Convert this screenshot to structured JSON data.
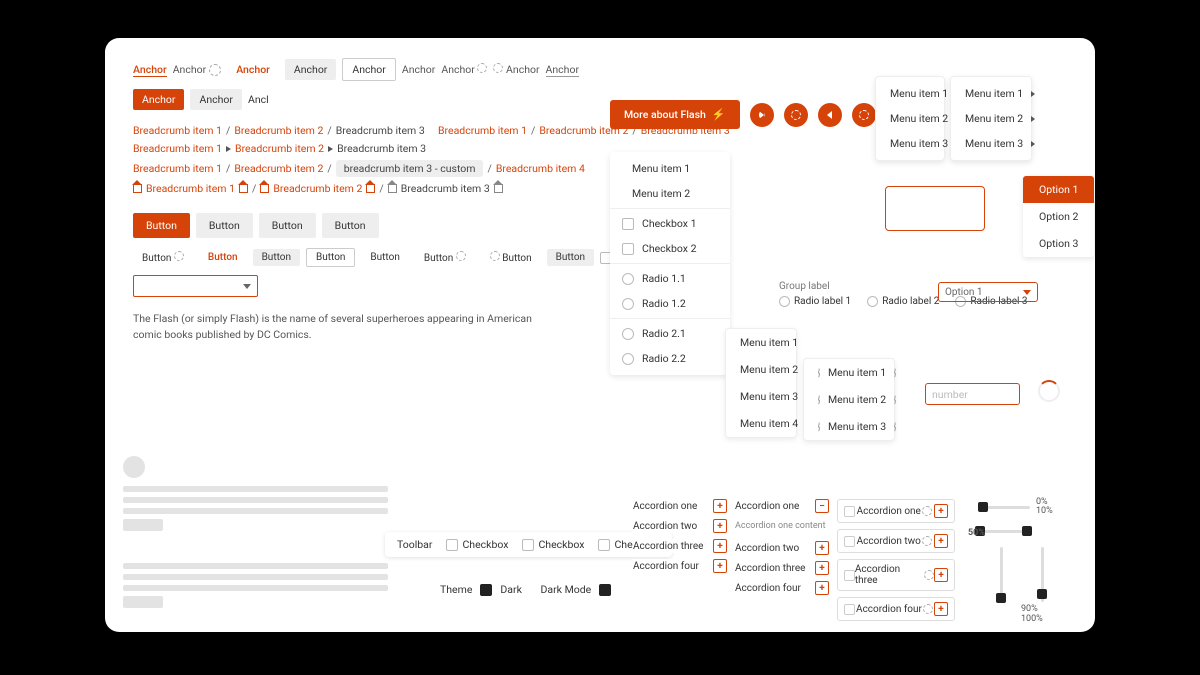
{
  "anchors": {
    "label": "Anchor",
    "partial": "Ancl"
  },
  "breadcrumbs": {
    "items": [
      "Breadcrumb item 1",
      "Breadcrumb item 2",
      "Breadcrumb item 3"
    ],
    "custom": "breadcrumb item 3 - custom",
    "item4": "Breadcrumb item 4"
  },
  "buttons": {
    "label": "Button",
    "checkbox": "Checkbox"
  },
  "flash": {
    "cta": "More about Flash",
    "text": "The Flash (or simply Flash) is the name of several superheroes appearing in American comic books published by DC Comics."
  },
  "toolbar": {
    "label": "Toolbar",
    "checkbox": "Checkbox"
  },
  "theme": {
    "label": "Theme",
    "dark": "Dark",
    "darkmode": "Dark Mode"
  },
  "menu": {
    "items": [
      "Menu item 1",
      "Menu item 2",
      "Menu item 3",
      "Menu item 4"
    ]
  },
  "form": {
    "cb1": "Checkbox 1",
    "cb2": "Checkbox 2",
    "r11": "Radio 1.1",
    "r12": "Radio 1.2",
    "r21": "Radio 2.1",
    "r22": "Radio 2.2"
  },
  "options": {
    "o1": "Option 1",
    "o2": "Option 2",
    "o3": "Option 3"
  },
  "radioGroup": {
    "label": "Group label",
    "r1": "Radio label 1",
    "r2": "Radio label 2",
    "r3": "Radio label 3"
  },
  "select": {
    "value": "Option 1"
  },
  "number": {
    "placeholder": "number"
  },
  "accordion": {
    "a1": "Accordion one",
    "a2": "Accordion two",
    "a3": "Accordion three",
    "a4": "Accordion four",
    "content": "Accordion one content"
  },
  "slider": {
    "p0": "0%",
    "p10": "10%",
    "p90": "90%",
    "p100": "100%",
    "mid": "50%"
  }
}
